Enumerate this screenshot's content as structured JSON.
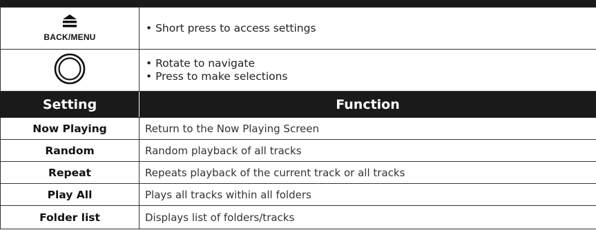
{
  "controls": {
    "back_menu": {
      "icon": "back-menu-icon",
      "label": "BACK/MENU",
      "bullets": [
        "• Short press to access settings"
      ]
    },
    "knob": {
      "icon": "rotary-knob-icon",
      "bullets": [
        "• Rotate to navigate",
        "• Press to make selections"
      ]
    }
  },
  "table": {
    "headers": {
      "setting": "Setting",
      "function": "Function"
    },
    "rows": [
      {
        "setting": "Now Playing",
        "function": "Return to the Now Playing Screen"
      },
      {
        "setting": "Random",
        "function": "Random playback of all tracks"
      },
      {
        "setting": "Repeat",
        "function": "Repeats playback of the current track or all tracks"
      },
      {
        "setting": "Play All",
        "function": "Plays all tracks within all folders"
      },
      {
        "setting": "Folder list",
        "function": "Displays list of folders/tracks"
      }
    ]
  },
  "colors": {
    "header_bg": "#1a1a1a",
    "header_text": "#ffffff",
    "border": "#333333"
  }
}
